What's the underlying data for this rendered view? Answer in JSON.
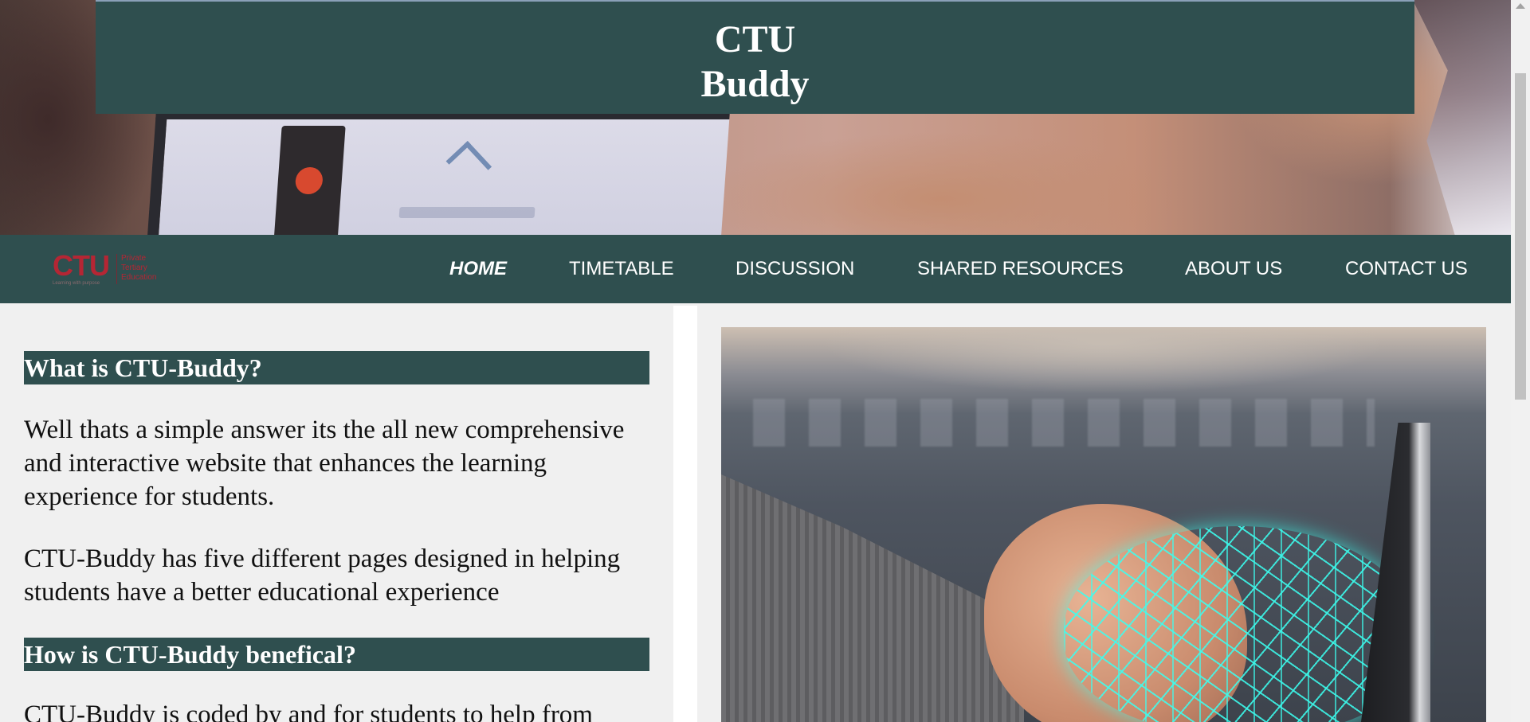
{
  "site": {
    "title_line1": "CTU",
    "title_line2": "Buddy"
  },
  "logo": {
    "mark": "CTU",
    "tagline": "Private\nTertiary\nEducation",
    "subline": "Learning with purpose"
  },
  "nav": {
    "items": [
      {
        "label": "HOME",
        "active": true
      },
      {
        "label": "TIMETABLE",
        "active": false
      },
      {
        "label": "DISCUSSION",
        "active": false
      },
      {
        "label": "SHARED RESOURCES",
        "active": false
      },
      {
        "label": "ABOUT US",
        "active": false
      },
      {
        "label": "CONTACT US",
        "active": false
      }
    ]
  },
  "content": {
    "heading1": "What is CTU-Buddy?",
    "para1": "Well thats a simple answer its the all new comprehensive and interactive website that enhances the learning experience for students.",
    "para2": "CTU-Buddy has five different pages designed in helping students have a better educational experience",
    "heading2": "How is CTU-Buddy benefical?",
    "para3": "CTU-Buddy is coded by and for students to help from"
  },
  "colors": {
    "primary": "#2f4f4f",
    "background": "#f0f0f0",
    "logo_red": "#b52634",
    "brain_glow": "#3cfff0"
  },
  "icons": {
    "hero": "laptop-desk-photo",
    "feature": "digital-brain-hand-photo"
  }
}
